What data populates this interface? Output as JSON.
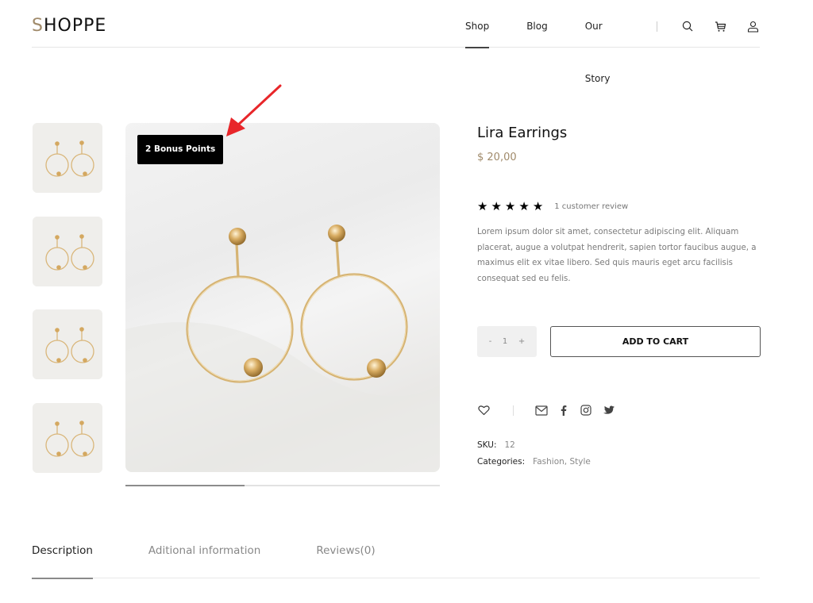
{
  "header": {
    "logo_first": "S",
    "logo_rest": "HOPPE",
    "nav": [
      {
        "label": "Shop",
        "active": true
      },
      {
        "label": "Blog",
        "active": false
      },
      {
        "label": "Our Story",
        "active": false
      }
    ],
    "icons": [
      "search-icon",
      "cart-icon",
      "user-icon"
    ]
  },
  "gallery": {
    "thumbnail_count": 4,
    "badge": "2 Bonus Points",
    "slider_progress": 0.38
  },
  "product": {
    "title": "Lira Earrings",
    "price": "$ 20,00",
    "rating": 5,
    "rating_max": 5,
    "review_text": "1 customer review",
    "description": "Lorem ipsum dolor sit amet, consectetur adipiscing elit. Aliquam placerat, augue a volutpat hendrerit, sapien tortor faucibus augue, a maximus elit ex vitae libero. Sed quis mauris eget arcu facilisis consequat sed eu felis.",
    "quantity": {
      "minus": "-",
      "value": "1",
      "plus": "+"
    },
    "add_to_cart": "ADD TO CART",
    "share_icons": [
      "heart-icon",
      "mail-icon",
      "facebook-icon",
      "instagram-icon",
      "twitter-icon"
    ],
    "sku_label": "SKU:",
    "sku_value": "12",
    "categories_label": "Categories:",
    "categories_value": "Fashion, Style"
  },
  "tabs": [
    {
      "label": "Description",
      "active": true
    },
    {
      "label": "Aditional information",
      "active": false
    },
    {
      "label": "Reviews(0)",
      "active": false
    }
  ],
  "colors": {
    "accent": "#a08a6a",
    "badge_bg": "#000000",
    "annotation_arrow": "#e8262a"
  }
}
